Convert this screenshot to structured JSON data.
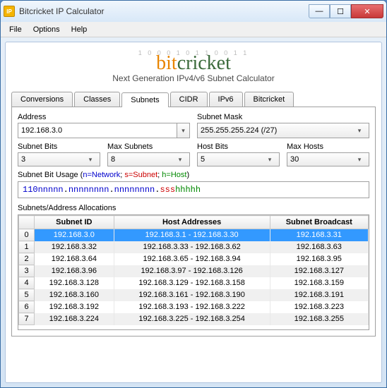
{
  "window": {
    "title": "Bitcricket IP Calculator"
  },
  "menu": {
    "file": "File",
    "options": "Options",
    "help": "Help"
  },
  "logo": {
    "binary": "1 0 0 0 1 0 1 1 0 0 1 1",
    "bit": "bit",
    "cricket": "cricket",
    "tagline": "Next Generation IPv4/v6 Subnet Calculator"
  },
  "tabs": {
    "conversions": "Conversions",
    "classes": "Classes",
    "subnets": "Subnets",
    "cidr": "CIDR",
    "ipv6": "IPv6",
    "bitcricket": "Bitcricket"
  },
  "fields": {
    "address_label": "Address",
    "address_value": "192.168.3.0",
    "mask_label": "Subnet Mask",
    "mask_value": "255.255.255.224  (/27)",
    "subnetbits_label": "Subnet Bits",
    "subnetbits_value": "3",
    "maxsubnets_label": "Max Subnets",
    "maxsubnets_value": "8",
    "hostbits_label": "Host Bits",
    "hostbits_value": "5",
    "maxhosts_label": "Max Hosts",
    "maxhosts_value": "30"
  },
  "usage": {
    "label_prefix": "Subnet Bit Usage (",
    "n_text": "n=Network",
    "sep1": "; ",
    "s_text": "s=Subnet",
    "sep2": "; ",
    "h_text": "h=Host",
    "label_suffix": ")",
    "seg1": "110",
    "seg2": "nnnnn",
    "dot": ".",
    "seg3": "nnnnnnnn",
    "seg4": "nnnnnnnn",
    "seg5": "sss",
    "seg6": "hhhhh"
  },
  "alloc": {
    "label": "Subnets/Address Allocations",
    "col_id": "Subnet ID",
    "col_hosts": "Host Addresses",
    "col_bcast": "Subnet Broadcast",
    "rows": [
      {
        "i": "0",
        "id": "192.168.3.0",
        "hosts": "192.168.3.1 - 192.168.3.30",
        "bcast": "192.168.3.31"
      },
      {
        "i": "1",
        "id": "192.168.3.32",
        "hosts": "192.168.3.33 - 192.168.3.62",
        "bcast": "192.168.3.63"
      },
      {
        "i": "2",
        "id": "192.168.3.64",
        "hosts": "192.168.3.65 - 192.168.3.94",
        "bcast": "192.168.3.95"
      },
      {
        "i": "3",
        "id": "192.168.3.96",
        "hosts": "192.168.3.97 - 192.168.3.126",
        "bcast": "192.168.3.127"
      },
      {
        "i": "4",
        "id": "192.168.3.128",
        "hosts": "192.168.3.129 - 192.168.3.158",
        "bcast": "192.168.3.159"
      },
      {
        "i": "5",
        "id": "192.168.3.160",
        "hosts": "192.168.3.161 - 192.168.3.190",
        "bcast": "192.168.3.191"
      },
      {
        "i": "6",
        "id": "192.168.3.192",
        "hosts": "192.168.3.193 - 192.168.3.222",
        "bcast": "192.168.3.223"
      },
      {
        "i": "7",
        "id": "192.168.3.224",
        "hosts": "192.168.3.225 - 192.168.3.254",
        "bcast": "192.168.3.255"
      }
    ]
  }
}
